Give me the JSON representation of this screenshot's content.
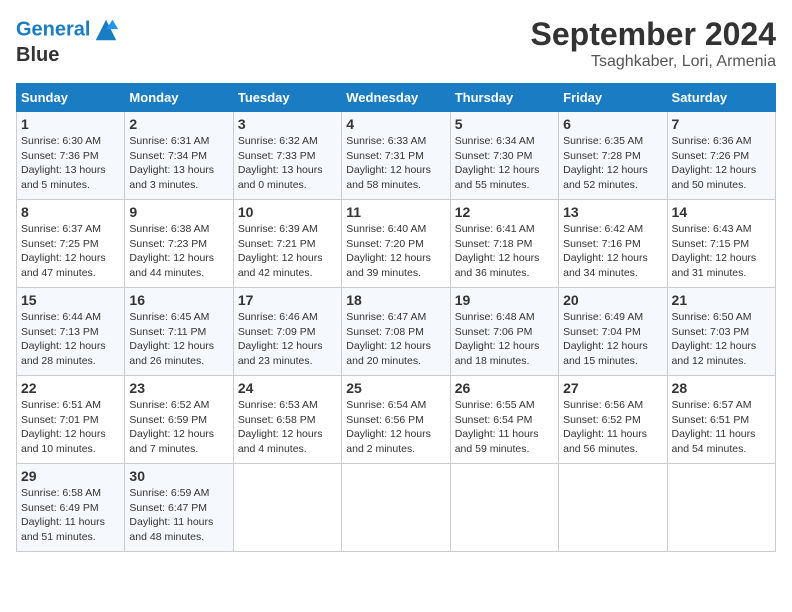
{
  "logo": {
    "line1": "General",
    "line2": "Blue"
  },
  "title": "September 2024",
  "subtitle": "Tsaghkaber, Lori, Armenia",
  "days_header": [
    "Sunday",
    "Monday",
    "Tuesday",
    "Wednesday",
    "Thursday",
    "Friday",
    "Saturday"
  ],
  "weeks": [
    [
      {
        "day": "1",
        "sunrise": "6:30 AM",
        "sunset": "7:36 PM",
        "daylight": "13 hours and 5 minutes."
      },
      {
        "day": "2",
        "sunrise": "6:31 AM",
        "sunset": "7:34 PM",
        "daylight": "13 hours and 3 minutes."
      },
      {
        "day": "3",
        "sunrise": "6:32 AM",
        "sunset": "7:33 PM",
        "daylight": "13 hours and 0 minutes."
      },
      {
        "day": "4",
        "sunrise": "6:33 AM",
        "sunset": "7:31 PM",
        "daylight": "12 hours and 58 minutes."
      },
      {
        "day": "5",
        "sunrise": "6:34 AM",
        "sunset": "7:30 PM",
        "daylight": "12 hours and 55 minutes."
      },
      {
        "day": "6",
        "sunrise": "6:35 AM",
        "sunset": "7:28 PM",
        "daylight": "12 hours and 52 minutes."
      },
      {
        "day": "7",
        "sunrise": "6:36 AM",
        "sunset": "7:26 PM",
        "daylight": "12 hours and 50 minutes."
      }
    ],
    [
      {
        "day": "8",
        "sunrise": "6:37 AM",
        "sunset": "7:25 PM",
        "daylight": "12 hours and 47 minutes."
      },
      {
        "day": "9",
        "sunrise": "6:38 AM",
        "sunset": "7:23 PM",
        "daylight": "12 hours and 44 minutes."
      },
      {
        "day": "10",
        "sunrise": "6:39 AM",
        "sunset": "7:21 PM",
        "daylight": "12 hours and 42 minutes."
      },
      {
        "day": "11",
        "sunrise": "6:40 AM",
        "sunset": "7:20 PM",
        "daylight": "12 hours and 39 minutes."
      },
      {
        "day": "12",
        "sunrise": "6:41 AM",
        "sunset": "7:18 PM",
        "daylight": "12 hours and 36 minutes."
      },
      {
        "day": "13",
        "sunrise": "6:42 AM",
        "sunset": "7:16 PM",
        "daylight": "12 hours and 34 minutes."
      },
      {
        "day": "14",
        "sunrise": "6:43 AM",
        "sunset": "7:15 PM",
        "daylight": "12 hours and 31 minutes."
      }
    ],
    [
      {
        "day": "15",
        "sunrise": "6:44 AM",
        "sunset": "7:13 PM",
        "daylight": "12 hours and 28 minutes."
      },
      {
        "day": "16",
        "sunrise": "6:45 AM",
        "sunset": "7:11 PM",
        "daylight": "12 hours and 26 minutes."
      },
      {
        "day": "17",
        "sunrise": "6:46 AM",
        "sunset": "7:09 PM",
        "daylight": "12 hours and 23 minutes."
      },
      {
        "day": "18",
        "sunrise": "6:47 AM",
        "sunset": "7:08 PM",
        "daylight": "12 hours and 20 minutes."
      },
      {
        "day": "19",
        "sunrise": "6:48 AM",
        "sunset": "7:06 PM",
        "daylight": "12 hours and 18 minutes."
      },
      {
        "day": "20",
        "sunrise": "6:49 AM",
        "sunset": "7:04 PM",
        "daylight": "12 hours and 15 minutes."
      },
      {
        "day": "21",
        "sunrise": "6:50 AM",
        "sunset": "7:03 PM",
        "daylight": "12 hours and 12 minutes."
      }
    ],
    [
      {
        "day": "22",
        "sunrise": "6:51 AM",
        "sunset": "7:01 PM",
        "daylight": "12 hours and 10 minutes."
      },
      {
        "day": "23",
        "sunrise": "6:52 AM",
        "sunset": "6:59 PM",
        "daylight": "12 hours and 7 minutes."
      },
      {
        "day": "24",
        "sunrise": "6:53 AM",
        "sunset": "6:58 PM",
        "daylight": "12 hours and 4 minutes."
      },
      {
        "day": "25",
        "sunrise": "6:54 AM",
        "sunset": "6:56 PM",
        "daylight": "12 hours and 2 minutes."
      },
      {
        "day": "26",
        "sunrise": "6:55 AM",
        "sunset": "6:54 PM",
        "daylight": "11 hours and 59 minutes."
      },
      {
        "day": "27",
        "sunrise": "6:56 AM",
        "sunset": "6:52 PM",
        "daylight": "11 hours and 56 minutes."
      },
      {
        "day": "28",
        "sunrise": "6:57 AM",
        "sunset": "6:51 PM",
        "daylight": "11 hours and 54 minutes."
      }
    ],
    [
      {
        "day": "29",
        "sunrise": "6:58 AM",
        "sunset": "6:49 PM",
        "daylight": "11 hours and 51 minutes."
      },
      {
        "day": "30",
        "sunrise": "6:59 AM",
        "sunset": "6:47 PM",
        "daylight": "11 hours and 48 minutes."
      },
      null,
      null,
      null,
      null,
      null
    ]
  ],
  "labels": {
    "sunrise": "Sunrise:",
    "sunset": "Sunset:",
    "daylight": "Daylight:"
  }
}
